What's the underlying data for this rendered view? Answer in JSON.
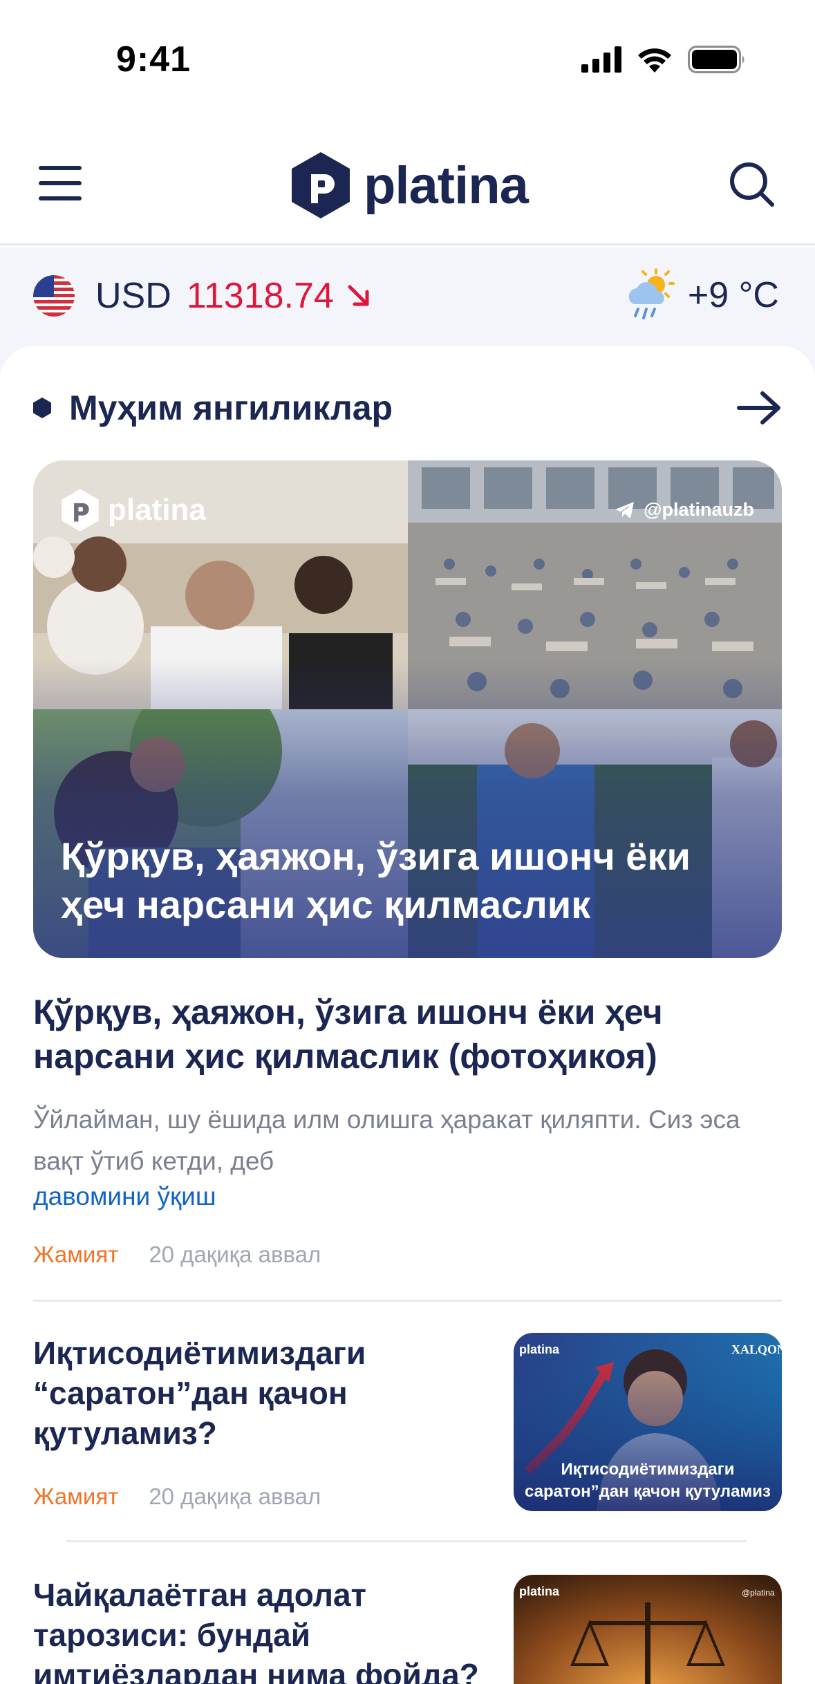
{
  "status_bar": {
    "time": "9:41"
  },
  "header": {
    "logo_text": "platina"
  },
  "info": {
    "currency_code": "USD",
    "currency_value": "11318.74",
    "temperature": "+9 °C"
  },
  "section": {
    "title": "Муҳим янгиликлар"
  },
  "hero": {
    "logo_text": "platina",
    "handle": "@platinauzb",
    "caption": "Қўрқув, ҳаяжон, ўзига ишонч ёки ҳеч нарсани ҳис қилмаслик"
  },
  "featured": {
    "title": "Қўрқув, ҳаяжон, ўзига ишонч ёки ҳеч нарсани ҳис қилмаслик (фотоҳикоя)",
    "excerpt": "Ўйлайман, шу ёшида илм олишга ҳаракат қиляпти. Сиз эса вақт ўтиб кетди, деб",
    "read_more": "давомини ўқиш",
    "category": "Жамият",
    "time": "20 дақиқа аввал"
  },
  "news": [
    {
      "title": "Иқтисодиётимиздаги “саратон”дан қачон қутуламиз?",
      "category": "Жамият",
      "time": "20 дақиқа аввал",
      "thumb_logo": "platina",
      "thumb_badge": "XALQON",
      "thumb_caption_1": "Иқтисодиётимиздаги",
      "thumb_caption_2": "саратон”дан қачон қутуламиз"
    },
    {
      "title": "Чайқалаётган адолат тарозиси: бундай имтиёзлардан нима фойда?",
      "thumb_logo": "platina",
      "thumb_handle": "@platina"
    }
  ]
}
